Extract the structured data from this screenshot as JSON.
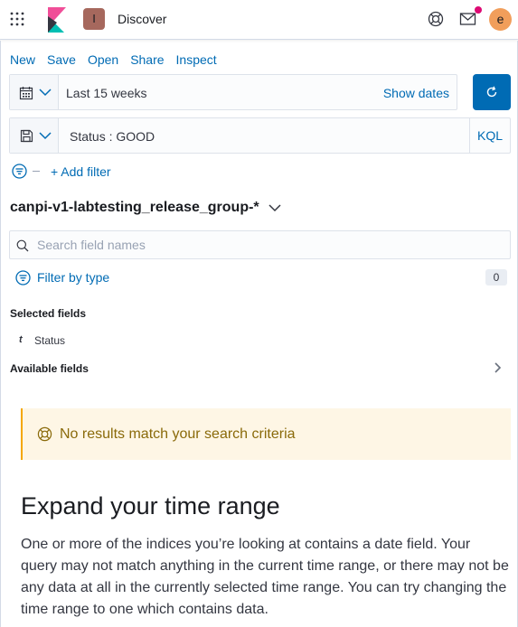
{
  "header": {
    "space_initial": "I",
    "app_title": "Discover",
    "user_initial": "e",
    "colors": {
      "space": "#a6685d",
      "user": "#f19e5b",
      "notification": "#dd0a73"
    }
  },
  "top_nav": {
    "new": "New",
    "save": "Save",
    "open": "Open",
    "share": "Share",
    "inspect": "Inspect"
  },
  "date_picker": {
    "value": "Last 15 weeks",
    "show_dates": "Show dates"
  },
  "query_bar": {
    "query": "Status : GOOD",
    "language": "KQL"
  },
  "filters": {
    "add_filter": "+ Add filter"
  },
  "sidebar": {
    "index_pattern": "canpi-v1-labtesting_release_group-*",
    "search_placeholder": "Search field names",
    "filter_by_type": "Filter by type",
    "filter_count": "0",
    "selected_fields_label": "Selected fields",
    "selected_fields": [
      {
        "type": "t",
        "name": "Status"
      }
    ],
    "available_fields_label": "Available fields"
  },
  "no_results": {
    "callout": "No results match your search criteria",
    "title": "Expand your time range",
    "body": "One or more of the indices you’re looking at contains a date field. Your query may not match anything in the current time range, or there may not be any data at all in the currently selected time range. You can try changing the time range to one which contains data."
  }
}
